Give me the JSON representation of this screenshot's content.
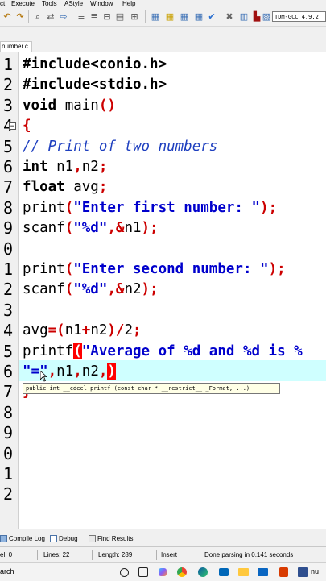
{
  "menu": {
    "items": [
      "ct",
      "Execute",
      "Tools",
      "AStyle",
      "Window",
      "Help"
    ]
  },
  "toolbar": {
    "compiler_select": "TDM-GCC 4.9.2"
  },
  "editor": {
    "tab_label": "number.c",
    "line_numbers": [
      "1",
      "2",
      "3",
      "4",
      "5",
      "6",
      "7",
      "8",
      "9",
      "0",
      "1",
      "2",
      "3",
      "4",
      "5",
      "6",
      "7",
      "8",
      "9",
      "0",
      "1",
      "2"
    ],
    "lines": {
      "l1": "#include<conio.h>",
      "l2": "#include<stdio.h>",
      "l3_kw": "void",
      "l3_rest": " main",
      "l3_sym": "()",
      "l4": "{",
      "l5": "// Print of two numbers",
      "l6_kw": "int",
      "l6_rest": " n1",
      "l6_sym1": ",",
      "l6_rest2": "n2",
      "l6_sym2": ";",
      "l7_kw": "float",
      "l7_rest": " avg",
      "l7_sym": ";",
      "l8_fn": "print",
      "l8_open": "(",
      "l8_str": "\"Enter first number: \"",
      "l8_close": ");",
      "l9_fn": "scanf",
      "l9_open": "(",
      "l9_str": "\"%d\"",
      "l9_mid": ",&",
      "l9_var": "n1",
      "l9_close": ");",
      "l11_fn": "print",
      "l11_open": "(",
      "l11_str": "\"Enter second number: \"",
      "l11_close": ");",
      "l12_fn": "scanf",
      "l12_open": "(",
      "l12_str": "\"%d\"",
      "l12_mid": ",&",
      "l12_var": "n2",
      "l12_close": ");",
      "l14_var": "avg",
      "l14_eq": "=(",
      "l14_a": "n1",
      "l14_plus": "+",
      "l14_b": "n2",
      "l14_close": ")/",
      "l14_num": "2",
      "l14_semi": ";",
      "l15_fn": "printf",
      "l15_open": "(",
      "l15_str": "\"Average of %d and %d is %",
      "l16_str": "\"=\"",
      "l16_sym1": ",",
      "l16_a": "n1",
      "l16_sym2": ",",
      "l16_b": "n2",
      "l16_sym3": ",",
      "l16_paren": ")",
      "l17": "}"
    },
    "tooltip": "public int __cdecl printf (const char * __restrict__ _Format, ...)",
    "fold_marker": "−"
  },
  "bottom_tabs": [
    "Compile Log",
    "Debug",
    "Find Results"
  ],
  "status": {
    "col": "el:   0",
    "lines": "Lines:   22",
    "length": "Length:   289",
    "mode": "Insert",
    "message": "Done parsing in 0.141 seconds"
  },
  "taskbar": {
    "search_label": "arch",
    "icons": [
      "task-view-icon",
      "edge-icon",
      "browser-icon",
      "file-explorer-icon",
      "store-icon",
      "mail-icon",
      "office-icon",
      "devcpp-icon"
    ],
    "overflow_label": "nu"
  },
  "colors": {
    "keyword": "#000000",
    "string": "#0000cc",
    "symbol": "#cc0000",
    "comment": "#1e3fbf",
    "current_line": "#cfffff",
    "brace_match": "#ff0000"
  }
}
